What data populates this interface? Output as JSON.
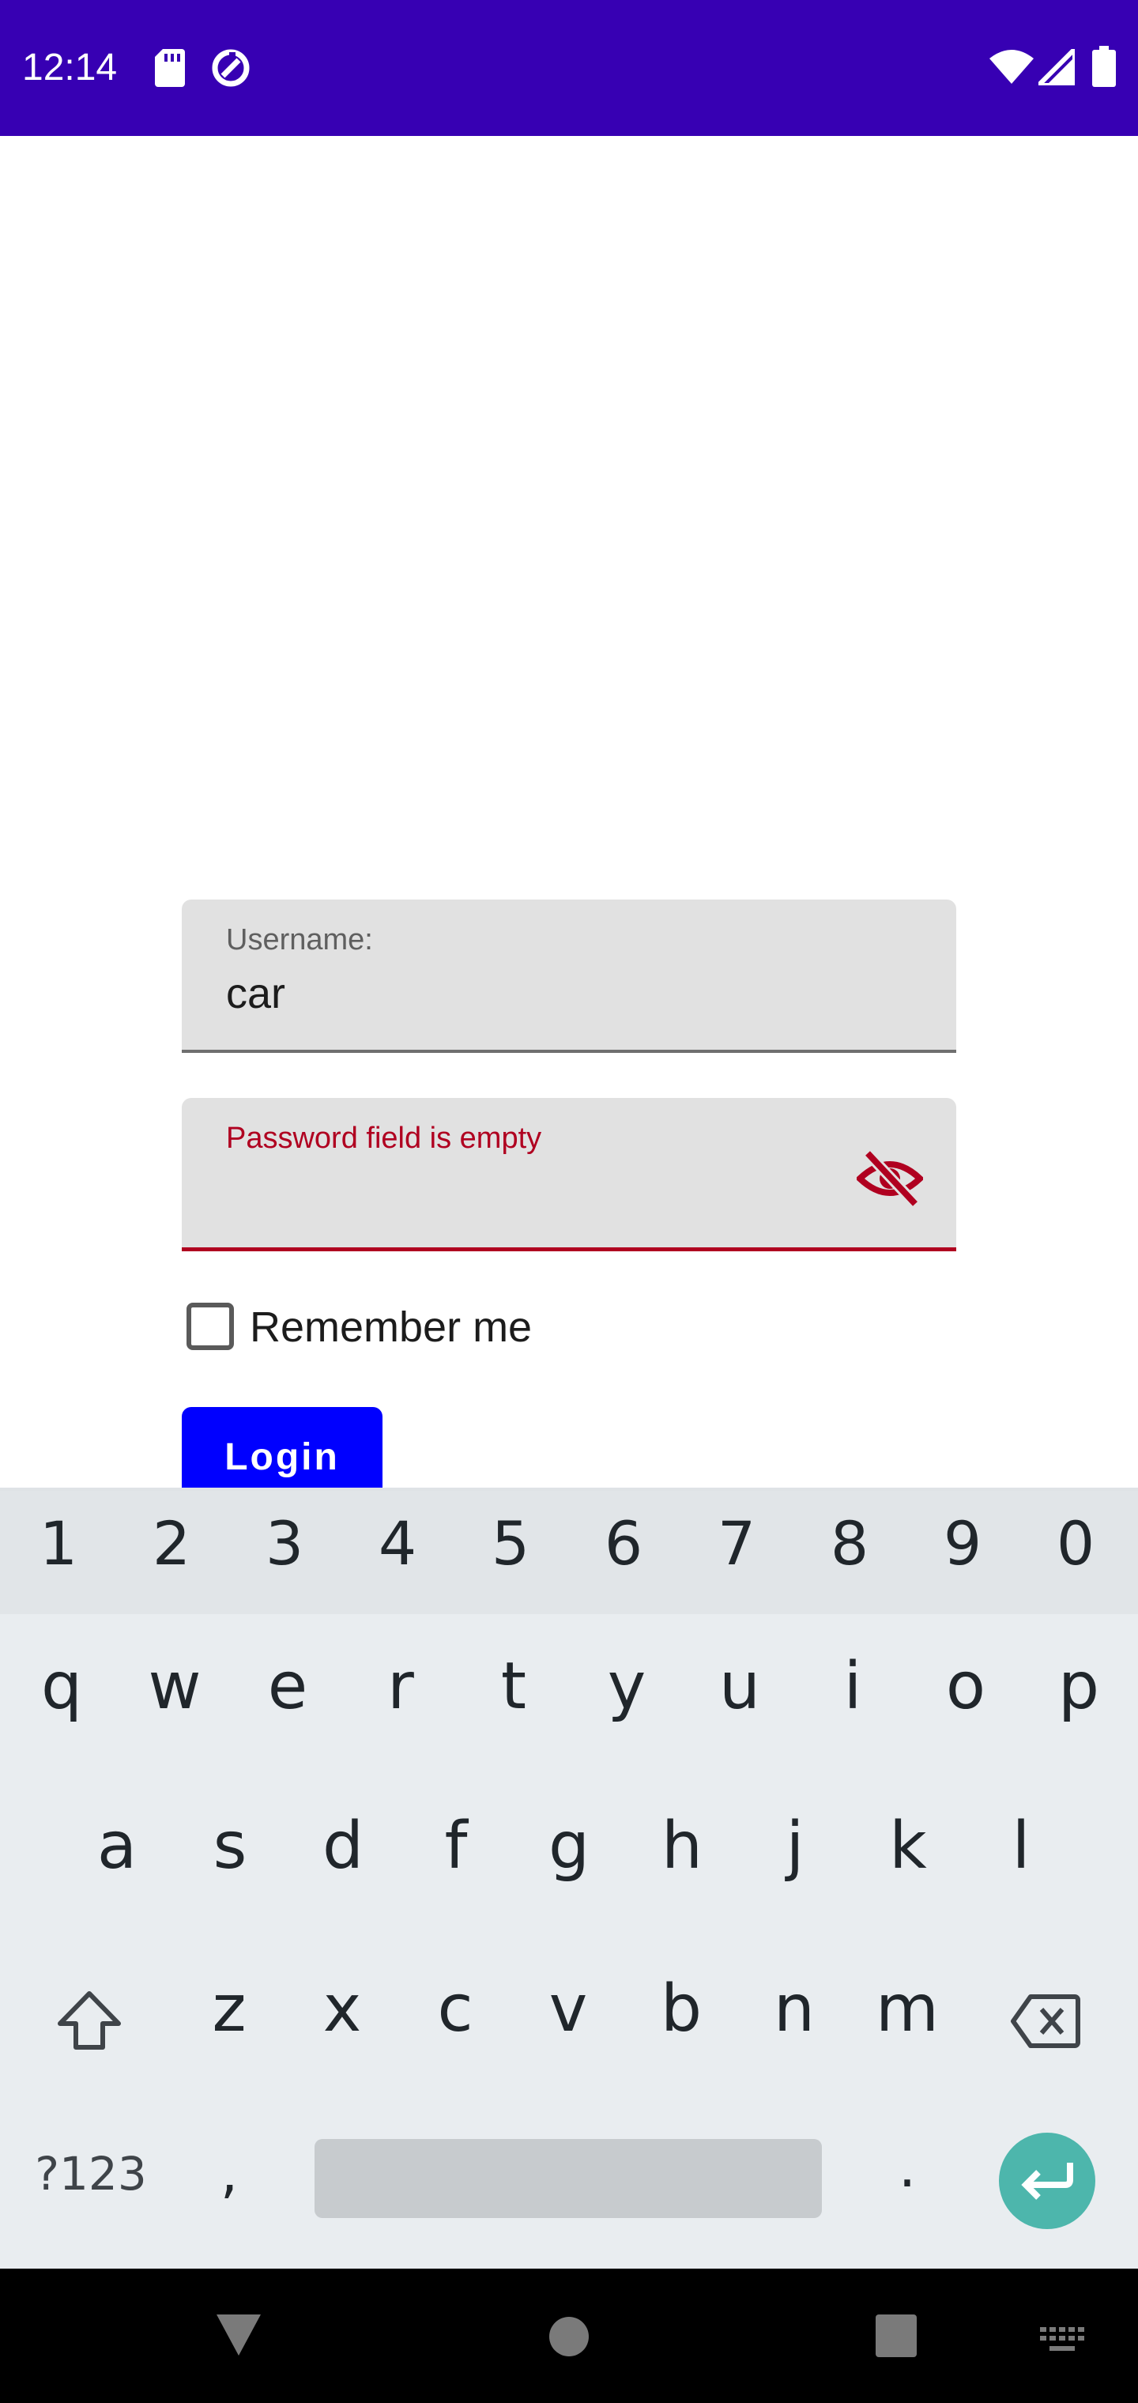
{
  "status_bar": {
    "time": "12:14",
    "icons_left": [
      "sd-card-icon",
      "data-saver-icon"
    ],
    "icons_right": [
      "wifi-icon",
      "signal-icon",
      "battery-icon"
    ],
    "color": "#3700b3"
  },
  "form": {
    "username": {
      "label": "Username:",
      "value": "car"
    },
    "password": {
      "error": "Password field is empty",
      "value": "",
      "toggle_icon": "visibility-off-icon"
    },
    "remember_label": "Remember me",
    "remember_checked": false,
    "login_label": "Login",
    "accent_color": "#0000ff",
    "error_color": "#b00020"
  },
  "keyboard": {
    "number_row": [
      "1",
      "2",
      "3",
      "4",
      "5",
      "6",
      "7",
      "8",
      "9",
      "0"
    ],
    "row1": [
      "q",
      "w",
      "e",
      "r",
      "t",
      "y",
      "u",
      "i",
      "o",
      "p"
    ],
    "row2": [
      "a",
      "s",
      "d",
      "f",
      "g",
      "h",
      "j",
      "k",
      "l"
    ],
    "row3": [
      "z",
      "x",
      "c",
      "v",
      "b",
      "n",
      "m"
    ],
    "symbols_label": "?123",
    "comma": ",",
    "period": ".",
    "enter_color": "#4db6ac"
  },
  "nav_bar": {
    "icons": [
      "back-icon",
      "home-icon",
      "recents-icon",
      "keyboard-switch-icon"
    ]
  }
}
